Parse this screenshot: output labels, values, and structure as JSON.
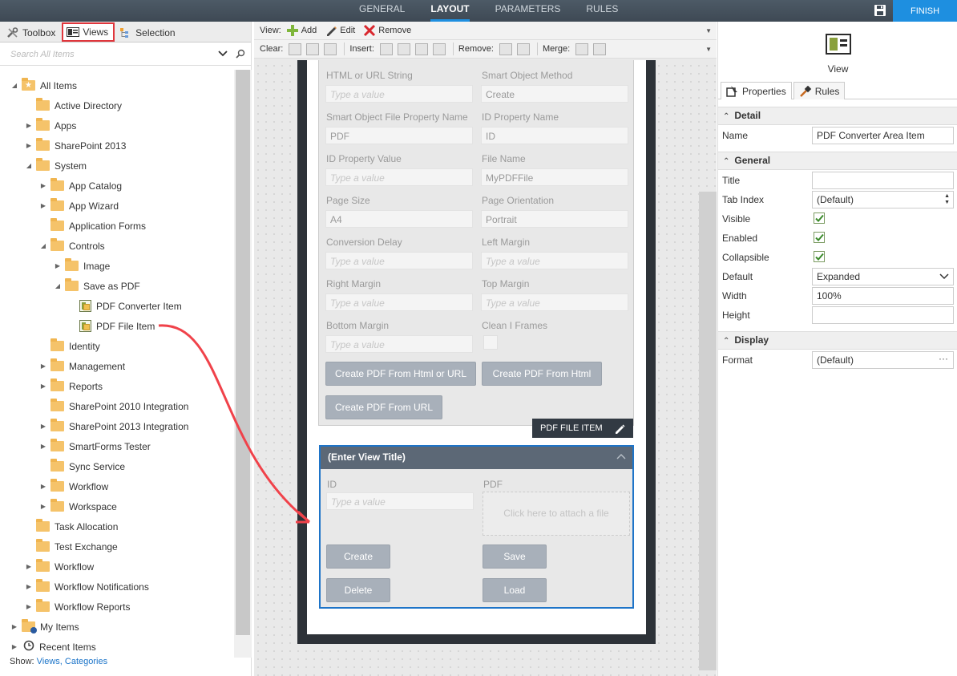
{
  "topbar": {
    "tabs": [
      "GENERAL",
      "LAYOUT",
      "PARAMETERS",
      "RULES"
    ],
    "active_tab": "LAYOUT",
    "finish_label": "FINISH",
    "accent_color": "#1e8fe0"
  },
  "left_panel": {
    "tabs": [
      {
        "label": "Toolbox",
        "icon": "tools-icon"
      },
      {
        "label": "Views",
        "icon": "view-icon",
        "selected": true
      },
      {
        "label": "Selection",
        "icon": "selection-icon"
      }
    ],
    "search_placeholder": "Search All Items",
    "tree": [
      {
        "label": "All Items",
        "level": 0,
        "expanded": true,
        "icon": "star-folder-icon"
      },
      {
        "label": "Active Directory",
        "level": 1,
        "icon": "folder-icon"
      },
      {
        "label": "Apps",
        "level": 1,
        "expandable": true,
        "icon": "folder-icon"
      },
      {
        "label": "SharePoint 2013",
        "level": 1,
        "expandable": true,
        "icon": "folder-icon"
      },
      {
        "label": "System",
        "level": 1,
        "expanded": true,
        "icon": "folder-icon"
      },
      {
        "label": "App Catalog",
        "level": 2,
        "expandable": true,
        "icon": "folder-icon"
      },
      {
        "label": "App Wizard",
        "level": 2,
        "expandable": true,
        "icon": "folder-icon"
      },
      {
        "label": "Application Forms",
        "level": 2,
        "icon": "folder-icon"
      },
      {
        "label": "Controls",
        "level": 2,
        "expanded": true,
        "icon": "folder-icon"
      },
      {
        "label": "Image",
        "level": 3,
        "expandable": true,
        "icon": "folder-icon"
      },
      {
        "label": "Save as PDF",
        "level": 3,
        "expanded": true,
        "icon": "folder-icon"
      },
      {
        "label": "PDF Converter Item",
        "level": 4,
        "icon": "view-item-icon"
      },
      {
        "label": "PDF File Item",
        "level": 4,
        "icon": "view-item-icon"
      },
      {
        "label": "Identity",
        "level": 2,
        "icon": "folder-icon"
      },
      {
        "label": "Management",
        "level": 2,
        "expandable": true,
        "icon": "folder-icon"
      },
      {
        "label": "Reports",
        "level": 2,
        "expandable": true,
        "icon": "folder-icon"
      },
      {
        "label": "SharePoint 2010 Integration",
        "level": 2,
        "icon": "folder-icon"
      },
      {
        "label": "SharePoint 2013 Integration",
        "level": 2,
        "expandable": true,
        "icon": "folder-icon"
      },
      {
        "label": "SmartForms Tester",
        "level": 2,
        "expandable": true,
        "icon": "folder-icon"
      },
      {
        "label": "Sync Service",
        "level": 2,
        "icon": "folder-icon"
      },
      {
        "label": "Workflow",
        "level": 2,
        "expandable": true,
        "icon": "folder-icon"
      },
      {
        "label": "Workspace",
        "level": 2,
        "expandable": true,
        "icon": "folder-icon"
      },
      {
        "label": "Task Allocation",
        "level": 1,
        "icon": "folder-icon"
      },
      {
        "label": "Test Exchange",
        "level": 1,
        "icon": "folder-icon"
      },
      {
        "label": "Workflow",
        "level": 1,
        "expandable": true,
        "icon": "folder-icon"
      },
      {
        "label": "Workflow Notifications",
        "level": 1,
        "expandable": true,
        "icon": "folder-icon"
      },
      {
        "label": "Workflow Reports",
        "level": 1,
        "expandable": true,
        "icon": "folder-icon"
      },
      {
        "label": "My Items",
        "level": 0,
        "expandable": true,
        "icon": "user-folder-icon"
      },
      {
        "label": "Recent Items",
        "level": 0,
        "expandable": true,
        "icon": "clock-icon"
      }
    ],
    "footer": {
      "show_label": "Show:",
      "views_link": "Views,",
      "categories_link": "Categories"
    }
  },
  "toolbar": {
    "row1": {
      "view_label": "View:",
      "add": "Add",
      "edit": "Edit",
      "remove": "Remove"
    },
    "row2": {
      "clear": "Clear:",
      "insert": "Insert:",
      "remove": "Remove:",
      "merge": "Merge:"
    }
  },
  "form": {
    "fields": [
      {
        "label": "HTML or URL String",
        "value": "Type a value",
        "placeholder": true
      },
      {
        "label": "Smart Object Method",
        "value": "Create"
      },
      {
        "label": "Smart Object File Property Name",
        "value": "PDF"
      },
      {
        "label": "ID Property Name",
        "value": "ID"
      },
      {
        "label": "ID Property Value",
        "value": "Type a value",
        "placeholder": true
      },
      {
        "label": "File Name",
        "value": "MyPDFFile"
      },
      {
        "label": "Page Size",
        "value": "A4"
      },
      {
        "label": "Page Orientation",
        "value": "Portrait"
      },
      {
        "label": "Conversion Delay",
        "value": "Type a value",
        "placeholder": true
      },
      {
        "label": "Left Margin",
        "value": "Type a value",
        "placeholder": true
      },
      {
        "label": "Right Margin",
        "value": "Type a value",
        "placeholder": true
      },
      {
        "label": "Top Margin",
        "value": "Type a value",
        "placeholder": true
      },
      {
        "label": "Bottom Margin",
        "value": "Type a value",
        "placeholder": true
      },
      {
        "label": "Clean I Frames",
        "checkbox": true
      }
    ],
    "buttons": [
      "Create PDF From Html or URL",
      "Create PDF From Html",
      "Create PDF From URL"
    ],
    "badge": "PDF FILE ITEM"
  },
  "view2": {
    "title": "(Enter View Title)",
    "id_label": "ID",
    "id_placeholder": "Type a value",
    "pdf_label": "PDF",
    "attach_text": "Click here to attach a file",
    "buttons": [
      "Create",
      "Save",
      "Delete",
      "Load"
    ]
  },
  "properties": {
    "view_label": "View",
    "tabs": [
      "Properties",
      "Rules"
    ],
    "detail_header": "Detail",
    "name_label": "Name",
    "name_value": "PDF Converter Area Item",
    "general_header": "General",
    "title_label": "Title",
    "title_value": "",
    "tab_index_label": "Tab Index",
    "tab_index_value": "(Default)",
    "visible_label": "Visible",
    "visible_checked": true,
    "enabled_label": "Enabled",
    "enabled_checked": true,
    "collapsible_label": "Collapsible",
    "collapsible_checked": true,
    "default_label": "Default",
    "default_value": "Expanded",
    "width_label": "Width",
    "width_value": "100%",
    "height_label": "Height",
    "height_value": "",
    "display_header": "Display",
    "format_label": "Format",
    "format_value": "(Default)"
  }
}
